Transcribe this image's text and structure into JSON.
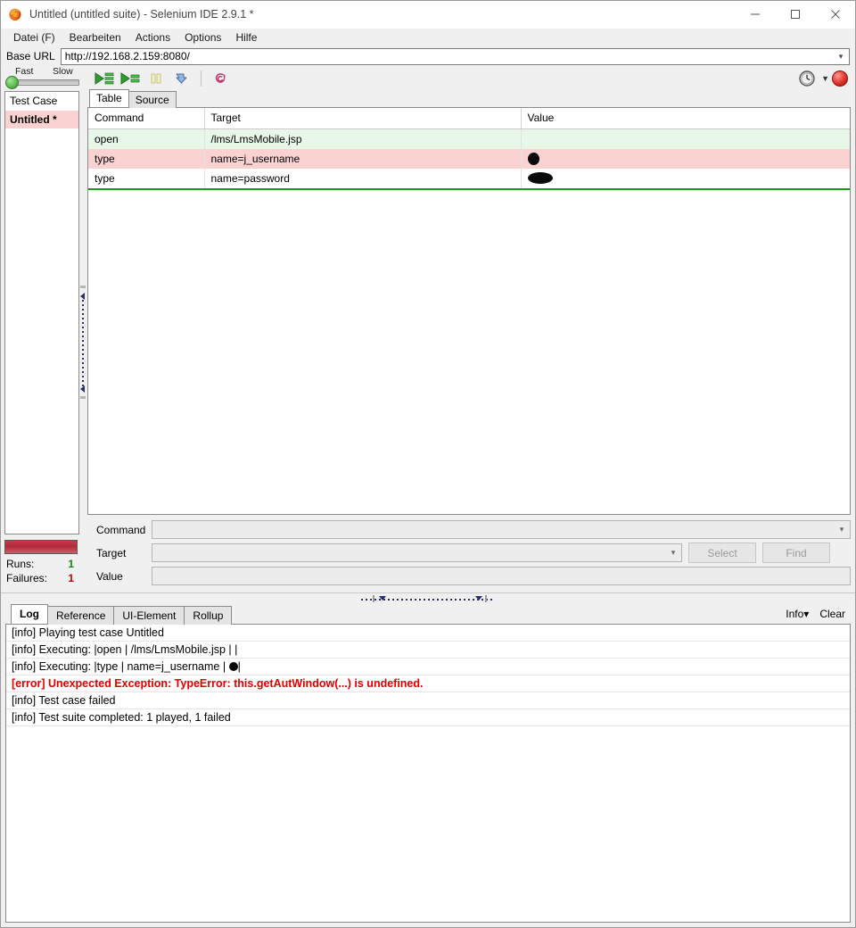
{
  "window": {
    "title": "Untitled (untitled suite) - Selenium IDE 2.9.1 *",
    "app_icon": "firefox-icon",
    "minimize_label": "minimize-icon",
    "maximize_label": "maximize-icon",
    "close_label": "close-icon"
  },
  "menubar": {
    "items": [
      {
        "label": "Datei (F)",
        "accel": "F"
      },
      {
        "label": "Bearbeiten",
        "accel": "B"
      },
      {
        "label": "Actions",
        "accel": "A"
      },
      {
        "label": "Options",
        "accel": "O"
      },
      {
        "label": "Hilfe",
        "accel": "H"
      }
    ]
  },
  "base_url": {
    "label": "Base URL",
    "value": "http://192.168.2.159:8080/",
    "placeholder": ""
  },
  "toolbar": {
    "speed_fast_label": "Fast",
    "speed_slow_label": "Slow",
    "speed_position": "fast",
    "buttons": [
      {
        "name": "play-entire-suite-button",
        "icon": "play-all-icon"
      },
      {
        "name": "play-current-test-case-button",
        "icon": "play-current-icon"
      },
      {
        "name": "pause-resume-button",
        "icon": "pause-icon",
        "disabled": true
      },
      {
        "name": "step-button",
        "icon": "step-icon"
      },
      {
        "name": "rollup-button",
        "icon": "rollup-spiral-icon"
      }
    ],
    "schedule_icon": "clock-icon",
    "schedule_chevron": "chevron-down-icon",
    "record_button": "record-dot-icon"
  },
  "left_pane": {
    "test_case_header": "Test Case",
    "test_cases": [
      {
        "label": "Untitled *",
        "state": "failed",
        "selected": true
      }
    ],
    "progress_state": "failed",
    "runs_label": "Runs:",
    "runs_value": "1",
    "failures_label": "Failures:",
    "failures_value": "1"
  },
  "editor": {
    "tabs": [
      {
        "label": "Table",
        "active": true
      },
      {
        "label": "Source",
        "active": false
      }
    ],
    "columns": [
      "Command",
      "Target",
      "Value"
    ],
    "rows": [
      {
        "command": "open",
        "target": "/lms/LmsMobile.jsp",
        "value": "",
        "value_redacted": "none",
        "state": "pass"
      },
      {
        "command": "type",
        "target": "name=j_username",
        "value": "",
        "value_redacted": "small",
        "state": "fail"
      },
      {
        "command": "type",
        "target": "name=password",
        "value": "",
        "value_redacted": "large",
        "state": "plain"
      }
    ]
  },
  "form": {
    "command_label": "Command",
    "command_value": "",
    "target_label": "Target",
    "target_value": "",
    "value_label": "Value",
    "value_value": "",
    "select_button": "Select",
    "find_button": "Find"
  },
  "log_panel": {
    "tabs": [
      {
        "label": "Log",
        "active": true
      },
      {
        "label": "Reference",
        "active": false
      },
      {
        "label": "UI-Element",
        "active": false
      },
      {
        "label": "Rollup",
        "active": false
      }
    ],
    "level_label": "Info",
    "level_chevron": "chevron-down-icon",
    "clear_label": "Clear",
    "lines": [
      {
        "text": "[info] Playing test case Untitled",
        "level": "info"
      },
      {
        "text": "[info] Executing: |open | /lms/LmsMobile.jsp | |",
        "level": "info"
      },
      {
        "text": "[info] Executing: |type | name=j_username | ",
        "level": "info",
        "redacted_suffix": "|"
      },
      {
        "text": "[error] Unexpected Exception: TypeError: this.getAutWindow(...) is undefined.",
        "level": "error"
      },
      {
        "text": "[info] Test case failed",
        "level": "info"
      },
      {
        "text": "[info] Test suite completed: 1 played, 1 failed",
        "level": "info"
      }
    ]
  },
  "colors": {
    "pass_row": "#e9f7e9",
    "fail_row": "#fbd2d2",
    "error_text": "#e00000",
    "runs_ok": "#108a10",
    "failures_bad": "#cc0000",
    "record_red": "#e0332b",
    "window_bg": "#f0f0f0"
  }
}
